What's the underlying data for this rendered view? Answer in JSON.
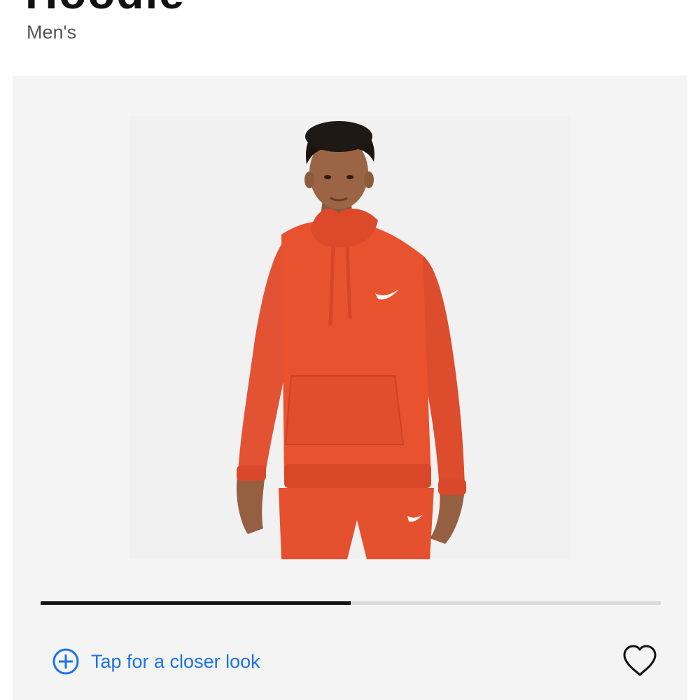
{
  "product": {
    "title": "Hoodie",
    "subtitle": "Men's"
  },
  "gallery": {
    "image_alt": "Orange fleece pullover hoodie worn by model",
    "progress_fraction": 0.5,
    "closer_look_label": "Tap for a closer look",
    "icons": {
      "closer_look": "plus-circle-icon",
      "favorite": "heart-outline-icon"
    },
    "colors": {
      "accent": "#1a73e8",
      "product": "#e8522f",
      "progress_fill": "#111111",
      "progress_track": "#d9d9d9"
    }
  }
}
